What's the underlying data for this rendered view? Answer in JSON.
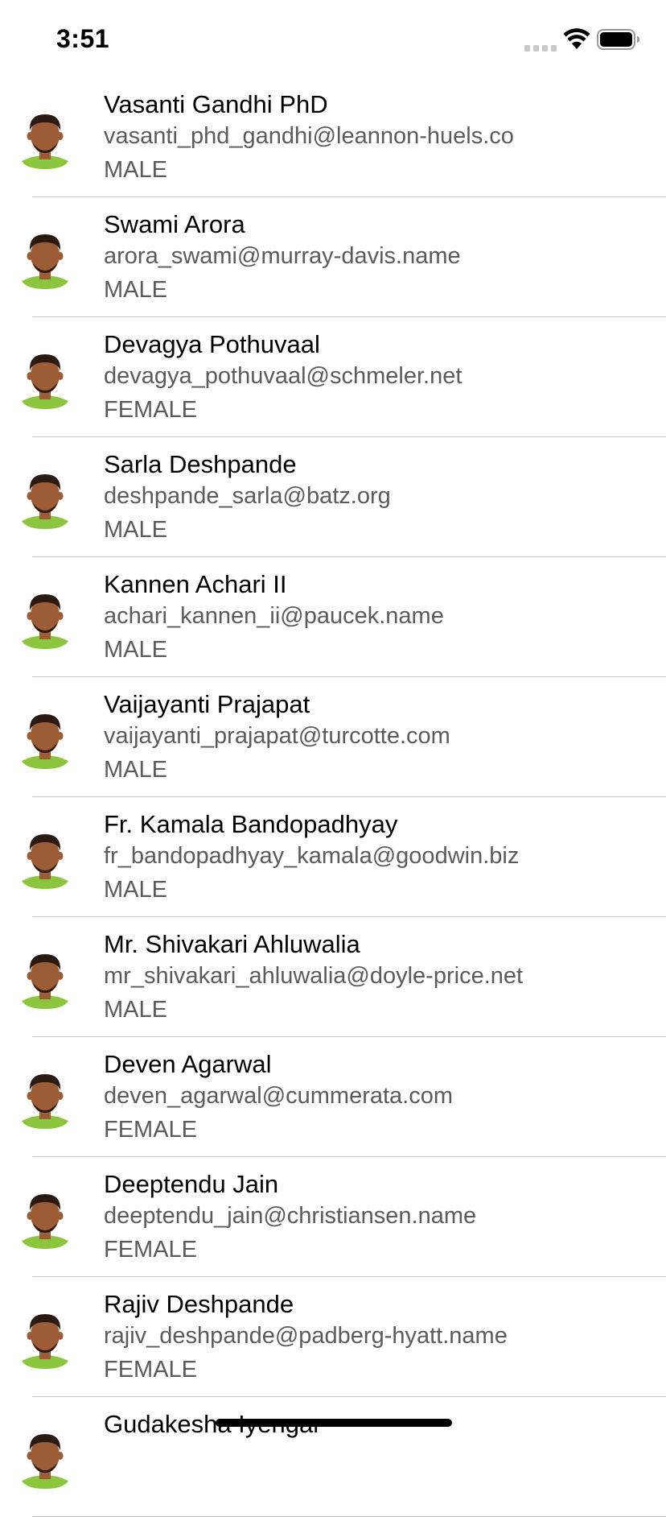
{
  "status_bar": {
    "time": "3:51",
    "icons": [
      "cellular-signal-icon",
      "wifi-icon",
      "battery-icon"
    ]
  },
  "contacts": [
    {
      "name": "Vasanti Gandhi PhD",
      "email": "vasanti_phd_gandhi@leannon-huels.co",
      "gender": "MALE"
    },
    {
      "name": "Swami Arora",
      "email": "arora_swami@murray-davis.name",
      "gender": "MALE"
    },
    {
      "name": "Devagya Pothuvaal",
      "email": "devagya_pothuvaal@schmeler.net",
      "gender": "FEMALE"
    },
    {
      "name": "Sarla Deshpande",
      "email": "deshpande_sarla@batz.org",
      "gender": "MALE"
    },
    {
      "name": "Kannen Achari II",
      "email": "achari_kannen_ii@paucek.name",
      "gender": "MALE"
    },
    {
      "name": "Vaijayanti Prajapat",
      "email": "vaijayanti_prajapat@turcotte.com",
      "gender": "MALE"
    },
    {
      "name": "Fr. Kamala Bandopadhyay",
      "email": "fr_bandopadhyay_kamala@goodwin.biz",
      "gender": "MALE"
    },
    {
      "name": "Mr. Shivakari Ahluwalia",
      "email": "mr_shivakari_ahluwalia@doyle-price.net",
      "gender": "MALE"
    },
    {
      "name": "Deven Agarwal",
      "email": "deven_agarwal@cummerata.com",
      "gender": "FEMALE"
    },
    {
      "name": "Deeptendu Jain",
      "email": "deeptendu_jain@christiansen.name",
      "gender": "FEMALE"
    },
    {
      "name": "Rajiv Deshpande",
      "email": "rajiv_deshpande@padberg-hyatt.name",
      "gender": "FEMALE"
    },
    {
      "name": "Gudakesha Iyengar",
      "email": "",
      "gender": ""
    }
  ],
  "colors": {
    "skin": "#9c5c35",
    "hair": "#2b1a12",
    "shirt": "#8cc63f",
    "divider": "#c6c6c8",
    "secondary_text": "#5b5b5b"
  }
}
